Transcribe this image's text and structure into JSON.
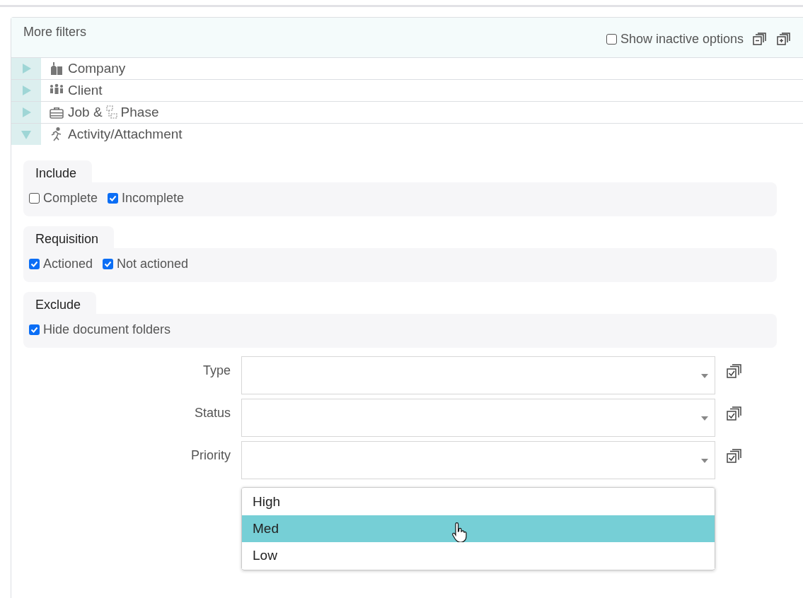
{
  "panel": {
    "title": "More filters",
    "show_inactive": {
      "label": "Show inactive options",
      "checked": false
    }
  },
  "tree": [
    {
      "kind": "company",
      "label": "Company",
      "expanded": false
    },
    {
      "kind": "client",
      "label": "Client",
      "expanded": false
    },
    {
      "kind": "job",
      "label": "Job &",
      "label_2": "Phase",
      "expanded": false
    },
    {
      "kind": "activity",
      "label": "Activity/Attachment",
      "expanded": true
    }
  ],
  "groups": [
    {
      "title": "Include",
      "options": [
        {
          "label": "Complete",
          "checked": false
        },
        {
          "label": "Incomplete",
          "checked": true
        }
      ]
    },
    {
      "title": "Requisition",
      "options": [
        {
          "label": "Actioned",
          "checked": true
        },
        {
          "label": "Not actioned",
          "checked": true
        }
      ]
    },
    {
      "title": "Exclude",
      "options": [
        {
          "label": "Hide document folders",
          "checked": true
        }
      ]
    }
  ],
  "fields": [
    {
      "label": "Type"
    },
    {
      "label": "Status"
    },
    {
      "label": "Priority",
      "menu": [
        {
          "label": "High",
          "selected": false
        },
        {
          "label": "Med",
          "selected": true
        },
        {
          "label": "Low",
          "selected": false
        }
      ]
    }
  ]
}
